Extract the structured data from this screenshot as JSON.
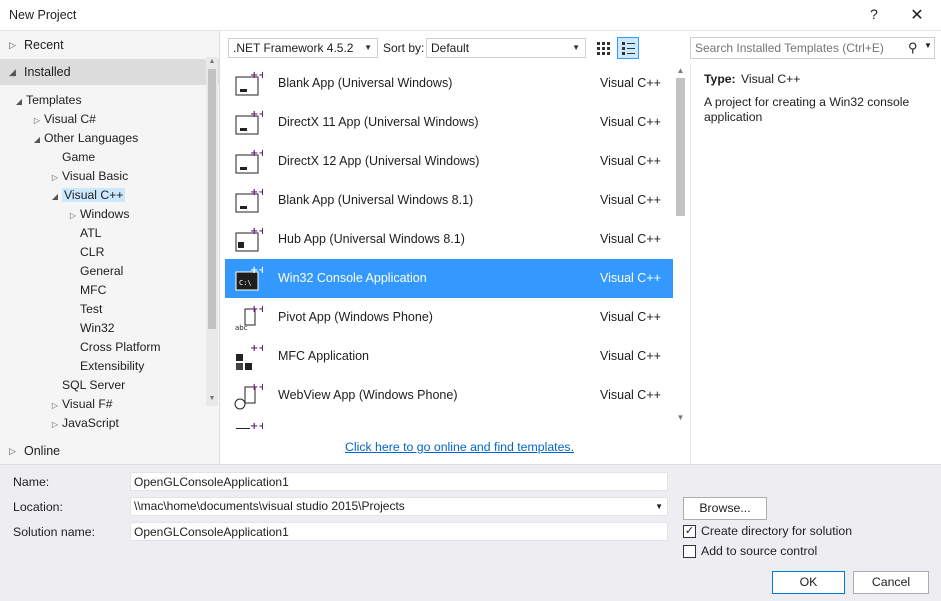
{
  "window": {
    "title": "New Project",
    "help": "?",
    "close": "✕"
  },
  "left": {
    "recent": "Recent",
    "installed": "Installed",
    "online": "Online",
    "tree": [
      {
        "label": "Templates",
        "arrow": "◢"
      },
      {
        "label": "Visual C#",
        "arrow": "▷"
      },
      {
        "label": "Other Languages",
        "arrow": "◢"
      },
      {
        "label": "Game",
        "arrow": ""
      },
      {
        "label": "Visual Basic",
        "arrow": "▷"
      },
      {
        "label": "Visual C++",
        "arrow": "◢"
      },
      {
        "label": "Windows",
        "arrow": "▷"
      },
      {
        "label": "ATL",
        "arrow": ""
      },
      {
        "label": "CLR",
        "arrow": ""
      },
      {
        "label": "General",
        "arrow": ""
      },
      {
        "label": "MFC",
        "arrow": ""
      },
      {
        "label": "Test",
        "arrow": ""
      },
      {
        "label": "Win32",
        "arrow": ""
      },
      {
        "label": "Cross Platform",
        "arrow": ""
      },
      {
        "label": "Extensibility",
        "arrow": ""
      },
      {
        "label": "SQL Server",
        "arrow": ""
      },
      {
        "label": "Visual F#",
        "arrow": "▷"
      },
      {
        "label": "JavaScript",
        "arrow": "▷"
      }
    ]
  },
  "toolbar": {
    "framework": ".NET Framework 4.5.2",
    "sort_by_label": "Sort by:",
    "sort_by_value": "Default",
    "search_placeholder": "Search Installed Templates (Ctrl+E)"
  },
  "templates": [
    {
      "name": "Blank App (Universal Windows)",
      "lang": "Visual C++",
      "icon": "blank-app-icon"
    },
    {
      "name": "DirectX 11 App (Universal Windows)",
      "lang": "Visual C++",
      "icon": "directx-app-icon"
    },
    {
      "name": "DirectX 12 App (Universal Windows)",
      "lang": "Visual C++",
      "icon": "directx-app-icon"
    },
    {
      "name": "Blank App (Universal Windows 8.1)",
      "lang": "Visual C++",
      "icon": "blank-app-icon"
    },
    {
      "name": "Hub App (Universal Windows 8.1)",
      "lang": "Visual C++",
      "icon": "hub-app-icon"
    },
    {
      "name": "Win32 Console Application",
      "lang": "Visual C++",
      "icon": "console-app-icon"
    },
    {
      "name": "Pivot App (Windows Phone)",
      "lang": "Visual C++",
      "icon": "pivot-app-icon"
    },
    {
      "name": "MFC Application",
      "lang": "Visual C++",
      "icon": "mfc-app-icon"
    },
    {
      "name": "WebView App (Windows Phone)",
      "lang": "Visual C++",
      "icon": "webview-app-icon"
    }
  ],
  "online_link": "Click here to go online and find templates.",
  "details": {
    "type_label": "Type:",
    "type_value": "Visual C++",
    "description": "A project for creating a Win32 console application"
  },
  "form": {
    "name_label": "Name:",
    "name_value": "OpenGLConsoleApplication1",
    "location_label": "Location:",
    "location_value": "\\\\mac\\home\\documents\\visual studio 2015\\Projects",
    "solution_label": "Solution name:",
    "solution_value": "OpenGLConsoleApplication1",
    "browse": "Browse...",
    "create_dir": "Create directory for solution",
    "add_source": "Add to source control",
    "ok": "OK",
    "cancel": "Cancel"
  },
  "colors": {
    "selection": "#3399ff",
    "link": "#0066cc",
    "tree_selection": "#cce8ff"
  }
}
